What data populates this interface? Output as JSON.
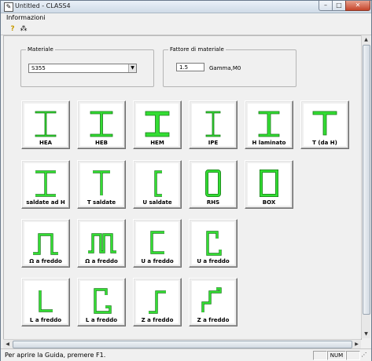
{
  "window": {
    "title": "Untitled - CLASS4",
    "app_icon": "app-icon"
  },
  "caption_buttons": {
    "minimize": "–",
    "maximize": "□",
    "close": "✕"
  },
  "menu": {
    "items": [
      {
        "label": "Informazioni"
      }
    ]
  },
  "toolbar": {
    "help_icon": "?",
    "context_help_icon": "⁂"
  },
  "materiale": {
    "label": "Materiale",
    "value": "S355"
  },
  "fattore": {
    "label": "Fattore di materiale",
    "value": "1.5",
    "unit": "Gamma,M0"
  },
  "sections": [
    {
      "label": "HEA",
      "icon": "hea-section-icon"
    },
    {
      "label": "HEB",
      "icon": "heb-section-icon"
    },
    {
      "label": "HEM",
      "icon": "hem-section-icon"
    },
    {
      "label": "IPE",
      "icon": "ipe-section-icon"
    },
    {
      "label": "H laminato",
      "icon": "h-rolled-section-icon"
    },
    {
      "label": "T (da H)",
      "icon": "t-from-h-section-icon"
    },
    {
      "label": "saldate ad H",
      "icon": "welded-h-section-icon"
    },
    {
      "label": "T saldate",
      "icon": "welded-t-section-icon"
    },
    {
      "label": "U saldate",
      "icon": "welded-u-section-icon"
    },
    {
      "label": "RHS",
      "icon": "rhs-section-icon"
    },
    {
      "label": "BOX",
      "icon": "box-section-icon"
    },
    {
      "label": "Ω  a freddo",
      "icon": "cold-omega-section-icon"
    },
    {
      "label": "Ω  a freddo",
      "icon": "cold-omega-lipped-section-icon"
    },
    {
      "label": "U a freddo",
      "icon": "cold-u-section-icon"
    },
    {
      "label": "U a freddo",
      "icon": "cold-u-lipped-section-icon"
    },
    {
      "label": "L a freddo",
      "icon": "cold-l-section-icon"
    },
    {
      "label": "L a freddo",
      "icon": "cold-l-lipped-section-icon"
    },
    {
      "label": "Z  a freddo",
      "icon": "cold-z-section-icon"
    },
    {
      "label": "Z  a freddo",
      "icon": "cold-z-lipped-section-icon"
    }
  ],
  "status": {
    "text": "Per aprire la Guida, premere F1.",
    "num": "NUM"
  },
  "colors": {
    "profile_fill": "#33dd33",
    "profile_stroke": "#1a7a1a",
    "profile_thin": "#22bb22"
  }
}
